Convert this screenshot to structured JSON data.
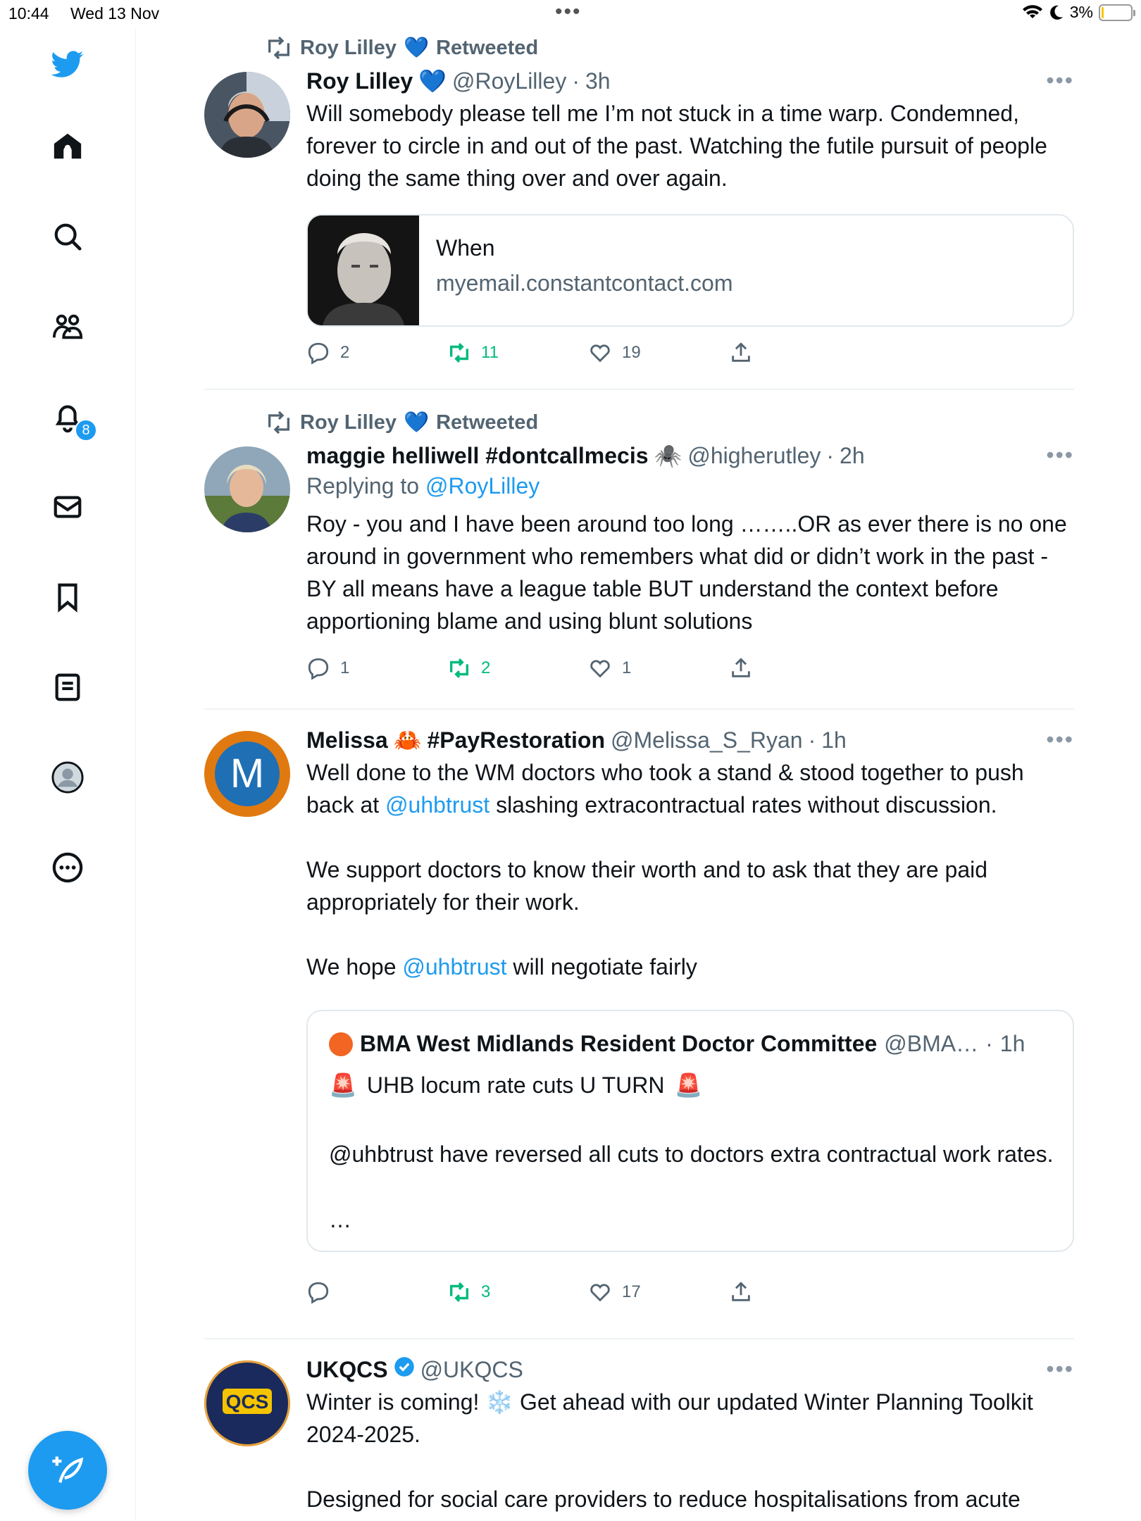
{
  "status": {
    "time": "10:44",
    "date": "Wed 13 Nov",
    "battery": "3%"
  },
  "nav": {
    "items": [
      "twitter-logo",
      "home",
      "explore",
      "communities",
      "notifications",
      "messages",
      "bookmarks",
      "lists",
      "profile",
      "more"
    ],
    "notifications_badge": "8"
  },
  "tweets": [
    {
      "retweeted_by": "Roy Lilley",
      "retweeted_label": "Retweeted",
      "name": "Roy Lilley",
      "handle": "@RoyLilley",
      "time": "3h",
      "text": "Will somebody please tell me I’m not stuck in a time warp. Condemned, forever to circle in and out of the past. Watching the futile pursuit of people doing the same thing over and over again.",
      "card": {
        "title": "When",
        "domain": "myemail.constantcontact.com"
      },
      "replies": "2",
      "retweets": "11",
      "likes": "19"
    },
    {
      "retweeted_by": "Roy Lilley",
      "retweeted_label": "Retweeted",
      "name": "maggie helliwell #dontcallmecis",
      "handle": "@higherutley",
      "time": "2h",
      "replying_label": "Replying to",
      "replying_to": "@RoyLilley",
      "text": "Roy - you and I have been around too long ……..OR as ever there is no one around in government who remembers what did or didn’t work in the past - BY all means have a league table BUT understand the context before apportioning blame and using blunt solutions",
      "replies": "1",
      "retweets": "2",
      "likes": "1"
    },
    {
      "name_part1": "Melissa",
      "name_part2": "#PayRestoration",
      "handle": "@Melissa_S_Ryan",
      "time": "1h",
      "text_a": "Well done to the WM doctors who took a stand & stood together to push back at ",
      "mention_a": "@uhbtrust",
      "text_b": " slashing extracontractual rates without discussion.",
      "text_c": "We support doctors to know their worth and to ask that they are paid appropriately for their work.",
      "text_d": "We hope ",
      "mention_b": "@uhbtrust",
      "text_e": " will negotiate fairly",
      "avatar_letter": "M",
      "quote": {
        "name": "BMA West Midlands Resident Doctor Committee",
        "handle": "@BMA…",
        "time": "1h",
        "line1": "UHB locum rate cuts U TURN",
        "line2": "@uhbtrust have reversed all cuts to doctors extra contractual work rates.",
        "ellipsis": "…"
      },
      "retweets": "3",
      "likes": "17"
    },
    {
      "name": "UKQCS",
      "handle": "@UKQCS",
      "avatar_text": "QCS",
      "text_a": "Winter is coming! ",
      "text_b": " Get ahead with our updated Winter Planning Toolkit 2024-2025.",
      "text_c": "Designed for social care providers to reduce hospitalisations from acute"
    }
  ],
  "colors": {
    "accent": "#1d9bf0",
    "retweet": "#00ba7c",
    "muted": "#536471"
  }
}
